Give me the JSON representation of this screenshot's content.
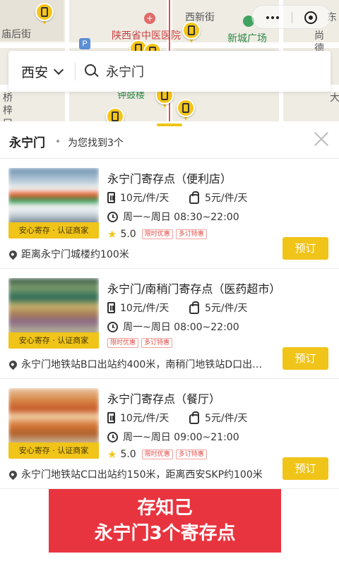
{
  "map": {
    "labels": {
      "miaohoujie": "庙后街",
      "xixinjie": "西新街",
      "hospital": "陕西省中医医院",
      "xinchengguangchang": "新城广场",
      "shang": "尚",
      "de": "德",
      "dong": "东",
      "da": "大",
      "qiao": "桥",
      "zi": "梓",
      "kou": "口",
      "fuzhenglou": "钟鼓楼"
    },
    "park_symbol": "P",
    "hospital_symbol": "+"
  },
  "search": {
    "city": "西安",
    "query": "永宁门"
  },
  "sheet": {
    "title": "永宁门",
    "count": "为您找到3个"
  },
  "cards": [
    {
      "name": "永宁门寄存点（便利店）",
      "big_price": "10元/件/天",
      "small_price": "5元/件/天",
      "hours": "周一~周日 08:30~22:00",
      "rating": "5.0",
      "promos": [
        "限时优惠",
        "多订特惠"
      ],
      "badge": "安心寄存 · 认证商家",
      "distance": "距离永宁门城楼约100米",
      "book": "预订"
    },
    {
      "name": "永宁门/南稍门寄存点（医药超市）",
      "big_price": "10元/件/天",
      "small_price": "5元/件/天",
      "hours": "周一~周日 08:00~22:00",
      "rating": "",
      "promos": [
        "限时优惠",
        "多订特惠"
      ],
      "badge": "安心寄存 · 认证商家",
      "distance": "永宁门地铁站B口出站约400米，南稍门地铁站D口出…",
      "book": "预订"
    },
    {
      "name": "永宁门寄存点（餐厅）",
      "big_price": "10元/件/天",
      "small_price": "5元/件/天",
      "hours": "周一~周日 09:00~21:00",
      "rating": "5.0",
      "promos": [
        "限时优惠",
        "多订特惠"
      ],
      "badge": "安心寄存 · 认证商家",
      "distance": "永宁门地铁站C口出站约150米，距离西安SKP约100米",
      "book": "预订"
    }
  ],
  "banner": {
    "line1": "存知己",
    "line2": "永宁门3个寄存点"
  },
  "colors": {
    "accent_yellow": "#f0c419",
    "banner_red": "#e8343f",
    "promo_red": "#e0504a"
  },
  "icons": {
    "map_pin": "luggage-pin-icon",
    "menu": "more-dots-icon",
    "close_mini": "target-icon",
    "search": "search-icon",
    "close": "close-icon",
    "luggage": "luggage-icon",
    "bag": "bag-icon",
    "clock": "clock-icon",
    "star": "star-icon",
    "location": "location-pin-icon"
  }
}
